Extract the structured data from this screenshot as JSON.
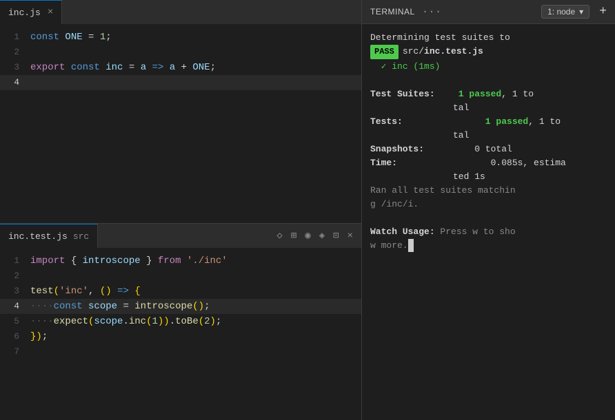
{
  "editor_top": {
    "tab_name": "inc.js",
    "close_icon": "×",
    "lines": [
      {
        "num": 1,
        "content": "const ONE = 1;"
      },
      {
        "num": 2,
        "content": ""
      },
      {
        "num": 3,
        "content": "export const inc = a => a + ONE;"
      },
      {
        "num": 4,
        "content": "",
        "active": true
      }
    ]
  },
  "editor_bottom": {
    "tab_name": "inc.test.js",
    "tab_path": "src",
    "lines": [
      {
        "num": 1,
        "content": "import { introscope } from './inc'"
      },
      {
        "num": 2,
        "content": ""
      },
      {
        "num": 3,
        "content": "test('inc', () => {"
      },
      {
        "num": 4,
        "content": "    const scope = introscope();",
        "active": true
      },
      {
        "num": 5,
        "content": "    expect(scope.inc(1)).toBe(2);"
      },
      {
        "num": 6,
        "content": "});"
      },
      {
        "num": 7,
        "content": ""
      }
    ],
    "icons": [
      "◇",
      "⊞",
      "◉",
      "◈",
      "⊡",
      "×"
    ]
  },
  "terminal": {
    "title": "TERMINAL",
    "dots": "···",
    "node_label": "1: node",
    "add_icon": "+",
    "lines": [
      {
        "text": "Determining test suites to",
        "type": "normal"
      },
      {
        "type": "pass_line",
        "badge": "PASS",
        "path": "src/inc.test.js"
      },
      {
        "type": "check_line",
        "text": "✓ inc (1ms)"
      },
      {
        "type": "blank"
      },
      {
        "type": "stat",
        "label": "Test Suites:",
        "value": "1 passed",
        "value2": ", 1 to"
      },
      {
        "type": "stat_cont",
        "text": "tal"
      },
      {
        "type": "stat",
        "label": "Tests:",
        "value": "1 passed",
        "value2": ", 1 to"
      },
      {
        "type": "stat_cont",
        "text": "tal"
      },
      {
        "type": "stat_plain",
        "label": "Snapshots:",
        "value": "0 total"
      },
      {
        "type": "stat_plain",
        "label": "Time:",
        "value": "0.085s, estima"
      },
      {
        "type": "stat_cont",
        "text": "ted 1s"
      },
      {
        "type": "normal_gray",
        "text": "Ran all test suites matchin"
      },
      {
        "type": "normal_gray",
        "text": "g /inc/i."
      },
      {
        "type": "blank"
      },
      {
        "type": "watch",
        "label": "Watch Usage:",
        "value": "Press w to sho"
      },
      {
        "type": "watch_cont",
        "text": "w more."
      }
    ]
  }
}
